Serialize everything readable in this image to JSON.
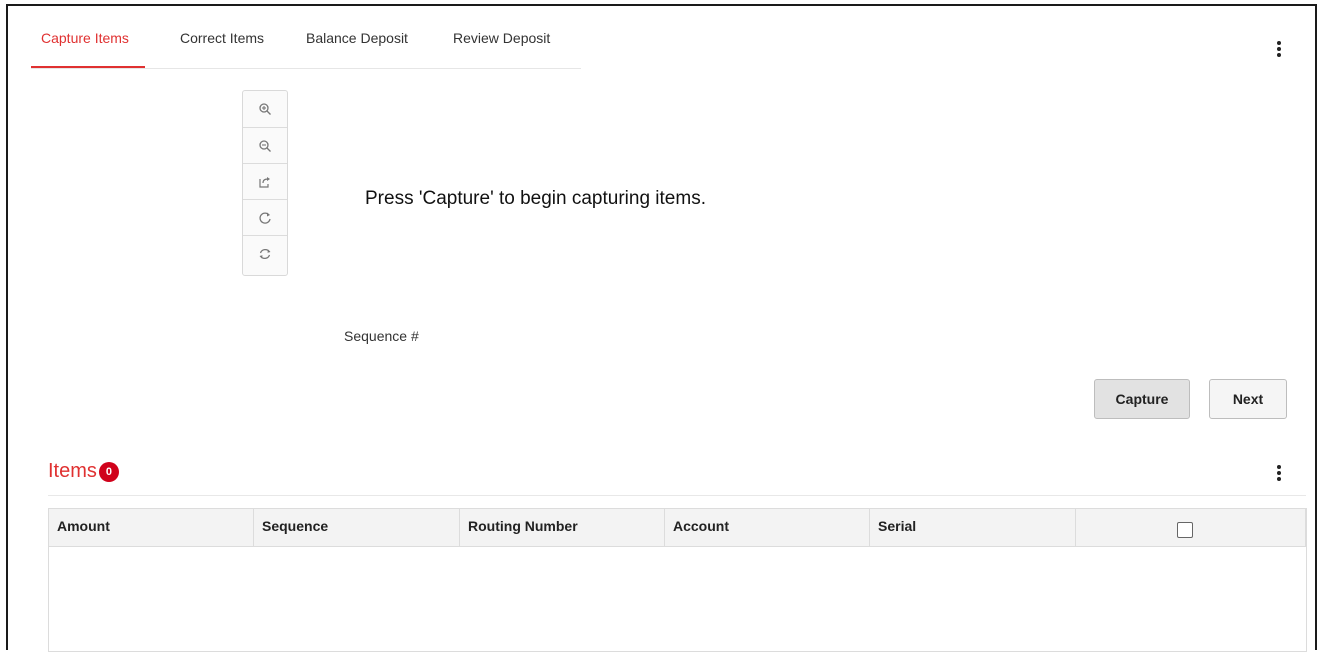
{
  "tabs": [
    {
      "label": "Capture Items",
      "active": true
    },
    {
      "label": "Correct Items",
      "active": false
    },
    {
      "label": "Balance Deposit",
      "active": false
    },
    {
      "label": "Review Deposit",
      "active": false
    }
  ],
  "toolbar": {
    "tools": [
      "zoom-in-icon",
      "zoom-out-icon",
      "flip-icon",
      "rotate-icon",
      "refresh-icon"
    ]
  },
  "capture": {
    "message": "Press 'Capture' to begin capturing items.",
    "sequence_label": "Sequence #",
    "capture_button": "Capture",
    "next_button": "Next"
  },
  "items": {
    "title": "Items",
    "count": "0",
    "columns": [
      "Amount",
      "Sequence",
      "Routing Number",
      "Account",
      "Serial"
    ],
    "rows": []
  },
  "colors": {
    "accent": "#e03131",
    "badge": "#d0021b"
  }
}
